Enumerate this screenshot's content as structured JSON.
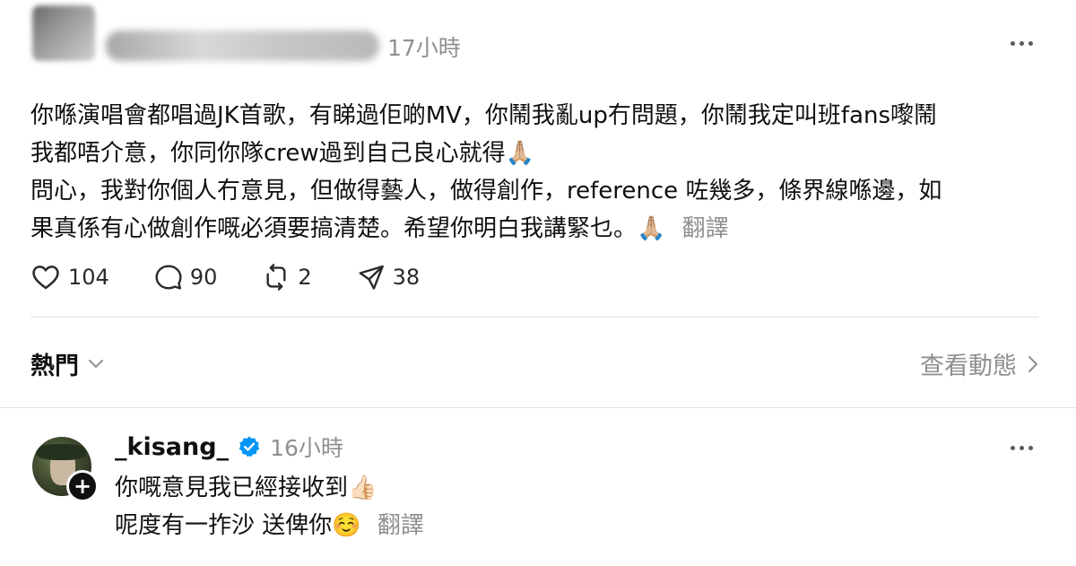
{
  "post": {
    "timestamp": "17小時",
    "lines": [
      "你喺演唱會都唱過JK首歌，有睇過佢啲MV，你鬧我亂up冇問題，你鬧我定叫班fans嚟鬧",
      "我都唔介意，你同你隊crew過到自己良心就得🙏🏼",
      "問心，我對你個人冇意見，但做得藝人，做得創作，reference 咗幾多，條界線喺邊，如",
      "果真係有心做創作嘅必須要搞清楚。希望你明白我講緊乜。🙏🏼"
    ],
    "translate_label": "翻譯",
    "likes": "104",
    "comments": "90",
    "reposts": "2",
    "shares": "38"
  },
  "section": {
    "sort_label": "熱門",
    "view_activity_label": "查看動態"
  },
  "reply": {
    "username": "_kisang_",
    "timestamp": "16小時",
    "lines": [
      "你嘅意見我已經接收到👍🏻",
      "呢度有一拃沙 送俾你☺️"
    ],
    "translate_label": "翻譯"
  },
  "colors": {
    "text": "#101010",
    "muted": "#8f8f8f",
    "verified": "#0095f6",
    "divider": "#e2e2e2"
  }
}
